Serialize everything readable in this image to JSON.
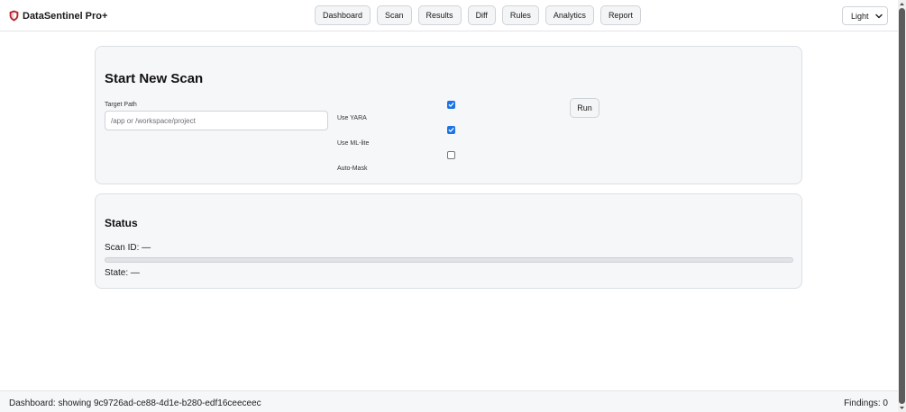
{
  "app": {
    "title": "DataSentinel Pro+"
  },
  "nav": {
    "items": [
      {
        "label": "Dashboard"
      },
      {
        "label": "Scan"
      },
      {
        "label": "Results"
      },
      {
        "label": "Diff"
      },
      {
        "label": "Rules"
      },
      {
        "label": "Analytics"
      },
      {
        "label": "Report"
      }
    ]
  },
  "theme": {
    "selected": "Light"
  },
  "scan": {
    "title": "Start New Scan",
    "target_label": "Target Path",
    "target_placeholder": "/app or /workspace/project",
    "target_value": "",
    "options": [
      {
        "label": "Use YARA",
        "checked": true
      },
      {
        "label": "Use ML-lite",
        "checked": true
      },
      {
        "label": "Auto-Mask",
        "checked": false
      }
    ],
    "run_label": "Run"
  },
  "status": {
    "title": "Status",
    "scan_id": "Scan ID: —",
    "state": "State: —",
    "progress_percent": 0
  },
  "footer": {
    "left": "Dashboard: showing 9c9726ad-ce88-4d1e-b280-edf16ceeceec",
    "right": "Findings: 0"
  },
  "colors": {
    "accent": "#1a73e8",
    "shield": "#b3262d"
  },
  "icons": {
    "brand": "shield-icon",
    "select": "chevron-down-icon",
    "checkbox": "check-icon"
  }
}
